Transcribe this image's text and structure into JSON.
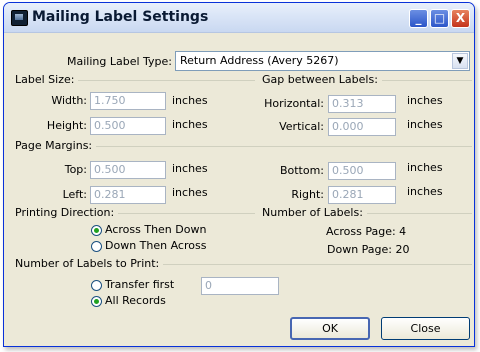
{
  "window": {
    "title": "Mailing Label Settings",
    "controls": [
      "_",
      "□",
      "X"
    ]
  },
  "label_type": {
    "label": "Mailing Label Type:",
    "value": "Return Address (Avery 5267)",
    "arrow": "▼"
  },
  "label_size": {
    "section": "Label Size:",
    "width_label": "Width:",
    "width_value": "1.750",
    "width_unit": "inches",
    "height_label": "Height:",
    "height_value": "0.500",
    "height_unit": "inches"
  },
  "gap": {
    "section": "Gap between Labels:",
    "horizontal_label": "Horizontal:",
    "horizontal_value": "0.313",
    "horizontal_unit": "inches",
    "vertical_label": "Vertical:",
    "vertical_value": "0.000",
    "vertical_unit": "inches"
  },
  "page_margins": {
    "section": "Page Margins:",
    "top_label": "Top:",
    "top_value": "0.500",
    "top_unit": "inches",
    "bottom_label": "Bottom:",
    "bottom_value": "0.500",
    "bottom_unit": "inches",
    "left_label": "Left:",
    "left_value": "0.281",
    "left_unit": "inches",
    "right_label": "Right:",
    "right_value": "0.281",
    "right_unit": "inches"
  },
  "printing_direction": {
    "section": "Printing Direction:",
    "option1": "Across Then Down",
    "option2": "Down Then Across",
    "selected": "Across Then Down"
  },
  "number_of_labels": {
    "section": "Number of Labels:",
    "across": "Across Page: 4",
    "down": "Down Page: 20"
  },
  "labels_to_print": {
    "section": "Number of Labels to Print:",
    "option1": "Transfer first",
    "transfer_value": "0",
    "option2": "All Records",
    "selected": "All Records"
  },
  "buttons": {
    "ok": "OK",
    "close": "Close"
  }
}
